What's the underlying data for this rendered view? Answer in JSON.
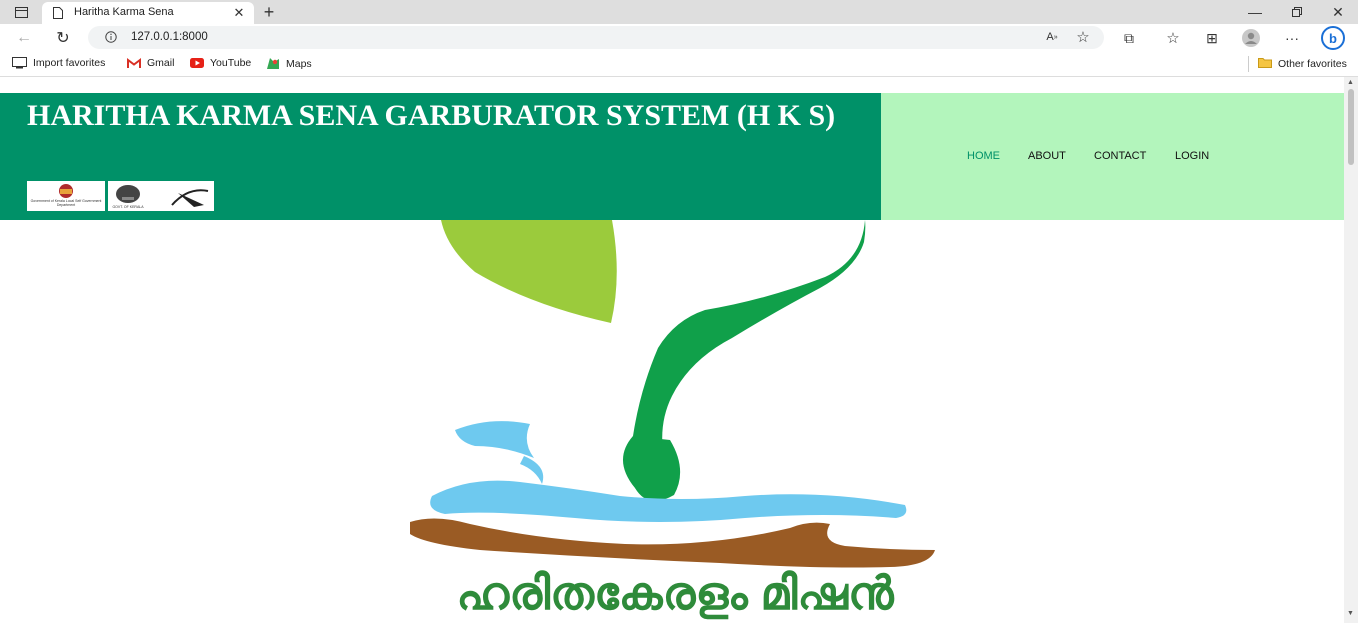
{
  "browser": {
    "tab_title": "Haritha Karma Sena",
    "url": "127.0.0.1:8000",
    "favorites": [
      "Import favorites",
      "Gmail",
      "YouTube",
      "Maps"
    ],
    "other_favorites": "Other favorites"
  },
  "site": {
    "title": "HARITHA KARMA SENA GARBURATOR SYSTEM (H K S)",
    "logos": [
      "Government of Kerala Local Self Government Department",
      "GOVT. OF KERALA",
      ""
    ],
    "nav": [
      {
        "label": "HOME",
        "color": "#009168"
      },
      {
        "label": "ABOUT",
        "color": "#111111"
      },
      {
        "label": "CONTACT",
        "color": "#111111"
      },
      {
        "label": "LOGIN",
        "color": "#111111"
      }
    ],
    "hero_text": "ഹരിതകേരളം മിഷൻ"
  },
  "colors": {
    "header_green": "#009168",
    "nav_bg": "#b3f5bc",
    "leaf_light": "#9bcb3c",
    "leaf_dark": "#10a04a",
    "water": "#6ec9ef",
    "soil": "#9a5b24",
    "malayalam_text": "#2e8b3a"
  },
  "icons": [
    "sidebar-icon",
    "tab-page-icon",
    "close-icon",
    "new-tab-icon",
    "minimize-icon",
    "restore-icon",
    "window-close-icon",
    "back-icon",
    "refresh-icon",
    "info-icon",
    "read-aloud-icon",
    "favorite-star-icon",
    "extensions-icon",
    "favorites-icon",
    "collections-icon",
    "profile-icon",
    "more-icon",
    "bing-icon",
    "folder-icon"
  ]
}
